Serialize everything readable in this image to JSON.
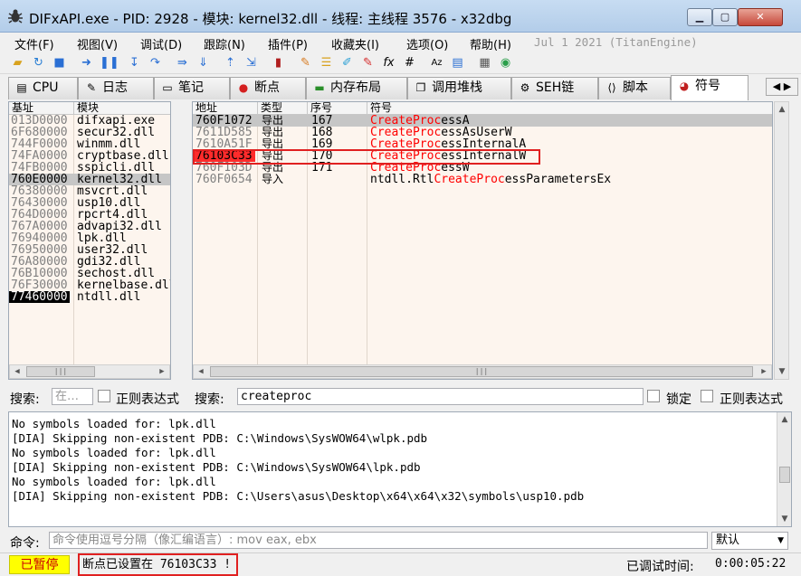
{
  "window": {
    "title": "DIFxAPI.exe - PID: 2928 - 模块: kernel32.dll - 线程: 主线程 3576 - x32dbg"
  },
  "menu": {
    "items": [
      "文件(F)",
      "视图(V)",
      "调试(D)",
      "跟踪(N)",
      "插件(P)",
      "收藏夹(I)",
      "选项(O)",
      "帮助(H)"
    ],
    "date": "Jul 1 2021 (TitanEngine)"
  },
  "tabs": [
    {
      "label": "CPU",
      "icon": "cpu-icon"
    },
    {
      "label": "日志",
      "icon": "log-icon"
    },
    {
      "label": "笔记",
      "icon": "notes-icon"
    },
    {
      "label": "断点",
      "icon": "breakpoint-icon"
    },
    {
      "label": "内存布局",
      "icon": "memory-icon"
    },
    {
      "label": "调用堆栈",
      "icon": "callstack-icon"
    },
    {
      "label": "SEH链",
      "icon": "seh-icon"
    },
    {
      "label": "脚本",
      "icon": "script-icon"
    },
    {
      "label": "符号",
      "icon": "symbol-icon"
    }
  ],
  "modules": {
    "headers": {
      "base": "基址",
      "module": "模块"
    },
    "rows": [
      {
        "base": "013D0000",
        "name": "difxapi.exe"
      },
      {
        "base": "6F680000",
        "name": "secur32.dll"
      },
      {
        "base": "744F0000",
        "name": "winmm.dll"
      },
      {
        "base": "74FA0000",
        "name": "cryptbase.dll"
      },
      {
        "base": "74FB0000",
        "name": "sspicli.dll"
      },
      {
        "base": "760E0000",
        "name": "kernel32.dll"
      },
      {
        "base": "76380000",
        "name": "msvcrt.dll"
      },
      {
        "base": "76430000",
        "name": "usp10.dll"
      },
      {
        "base": "764D0000",
        "name": "rpcrt4.dll"
      },
      {
        "base": "767A0000",
        "name": "advapi32.dll"
      },
      {
        "base": "76940000",
        "name": "lpk.dll"
      },
      {
        "base": "76950000",
        "name": "user32.dll"
      },
      {
        "base": "76A80000",
        "name": "gdi32.dll"
      },
      {
        "base": "76B10000",
        "name": "sechost.dll"
      },
      {
        "base": "76F30000",
        "name": "kernelbase.dll"
      },
      {
        "base": "77460000",
        "name": "ntdll.dll"
      }
    ]
  },
  "symbols": {
    "headers": {
      "address": "地址",
      "type": "类型",
      "ordinal": "序号",
      "symbol": "符号"
    },
    "rows": [
      {
        "address": "760F1072",
        "type": "导出",
        "ordinal": "167",
        "pre": "",
        "match": "CreateProc",
        "post": "essA"
      },
      {
        "address": "7611D585",
        "type": "导出",
        "ordinal": "168",
        "pre": "",
        "match": "CreateProc",
        "post": "essAsUserW"
      },
      {
        "address": "7610A51F",
        "type": "导出",
        "ordinal": "169",
        "pre": "",
        "match": "CreateProc",
        "post": "essInternalA"
      },
      {
        "address": "76103C33",
        "type": "导出",
        "ordinal": "170",
        "pre": "",
        "match": "CreateProc",
        "post": "essInternalW"
      },
      {
        "address": "760F103D",
        "type": "导出",
        "ordinal": "171",
        "pre": "",
        "match": "CreateProc",
        "post": "essW"
      },
      {
        "address": "760F0654",
        "type": "导入",
        "ordinal": "",
        "pre": "ntdll.Rtl",
        "match": "CreateProc",
        "post": "essParametersEx"
      }
    ]
  },
  "search": {
    "label1": "搜索:",
    "placeholder1": "在…",
    "regex1": "正则表达式",
    "label2": "搜索:",
    "value2": "createproc",
    "lock": "锁定",
    "regex2": "正则表达式"
  },
  "log": {
    "lines": [
      "No symbols loaded for: lpk.dll",
      "[DIA] Skipping non-existent PDB: C:\\Windows\\SysWOW64\\wlpk.pdb",
      "No symbols loaded for: lpk.dll",
      "[DIA] Skipping non-existent PDB: C:\\Windows\\SysWOW64\\lpk.pdb",
      "No symbols loaded for: lpk.dll",
      "[DIA] Skipping non-existent PDB: C:\\Users\\asus\\Desktop\\x64\\x64\\x32\\symbols\\usp10.pdb"
    ]
  },
  "command": {
    "label": "命令:",
    "placeholder": "命令使用逗号分隔（像汇编语言）: mov eax, ebx",
    "default_option": "默认"
  },
  "status": {
    "paused": "已暂停",
    "message": "断点已设置在 76103C33 !",
    "time_label": "已调试时间:",
    "time": "0:00:05:22"
  }
}
